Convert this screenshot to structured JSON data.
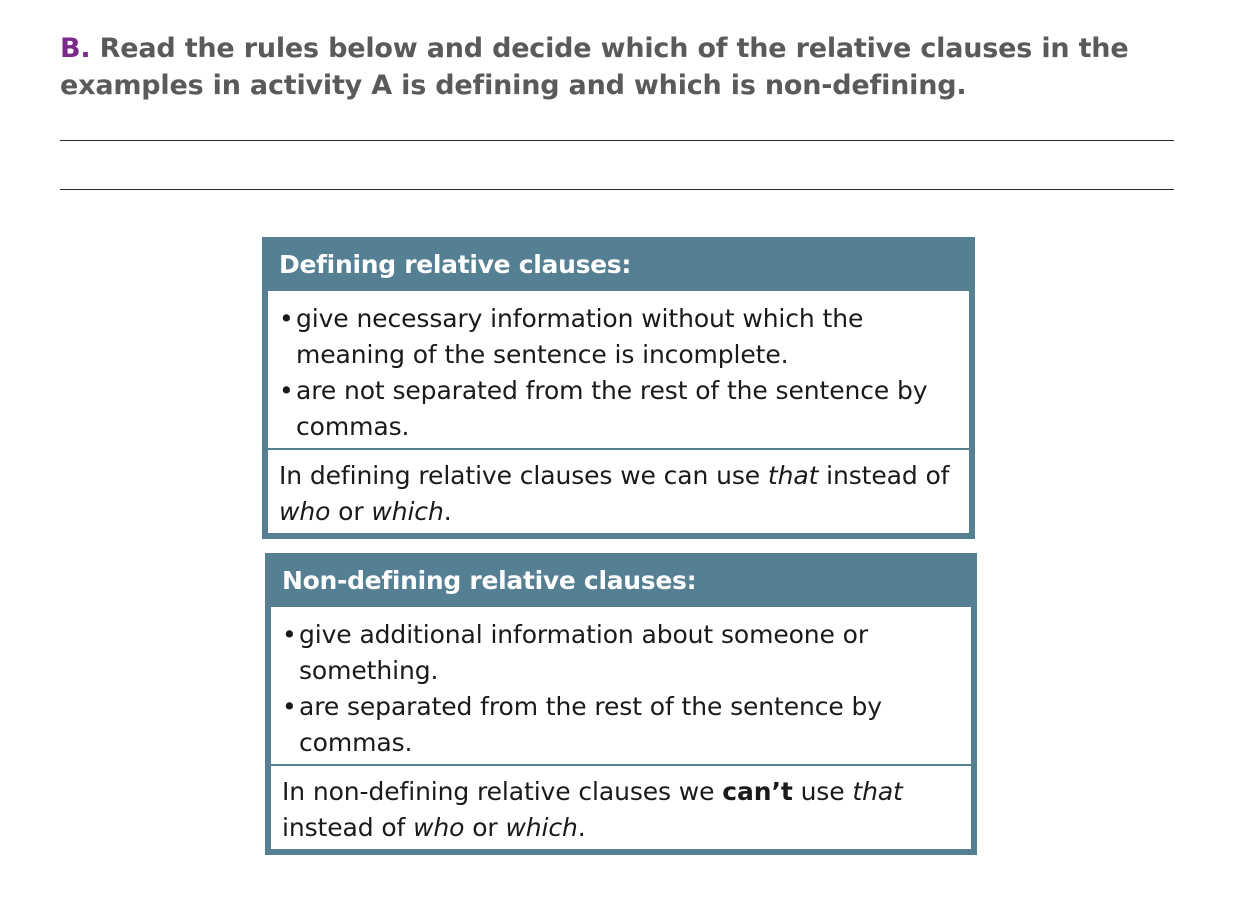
{
  "instruction": {
    "letter": "B",
    "dot": ".",
    "text": " Read the rules below and decide which of the relative clauses in the examples in activity A is defining and which is non-defining."
  },
  "defining": {
    "title": "Defining relative clauses:",
    "bullets": [
      "give necessary information without which the meaning of the sentence is incomplete.",
      "are not separated from the rest of the sentence by commas."
    ],
    "note": {
      "part1": "In defining relative clauses we can use ",
      "that": "that",
      "part2": " instead of ",
      "who": "who",
      "or": " or ",
      "which": "which",
      "end": "."
    }
  },
  "nondefining": {
    "title": "Non-defining relative clauses:",
    "bullets": [
      "give additional information about someone or something.",
      "are separated from the rest of the sentence by commas."
    ],
    "note": {
      "part1": "In non-defining relative clauses we ",
      "cant": "can’t",
      "part2": " use ",
      "that": "that",
      "part3": " instead of ",
      "who": "who",
      "or": " or ",
      "which": "which",
      "end": "."
    }
  },
  "bullet_glyph": "•"
}
